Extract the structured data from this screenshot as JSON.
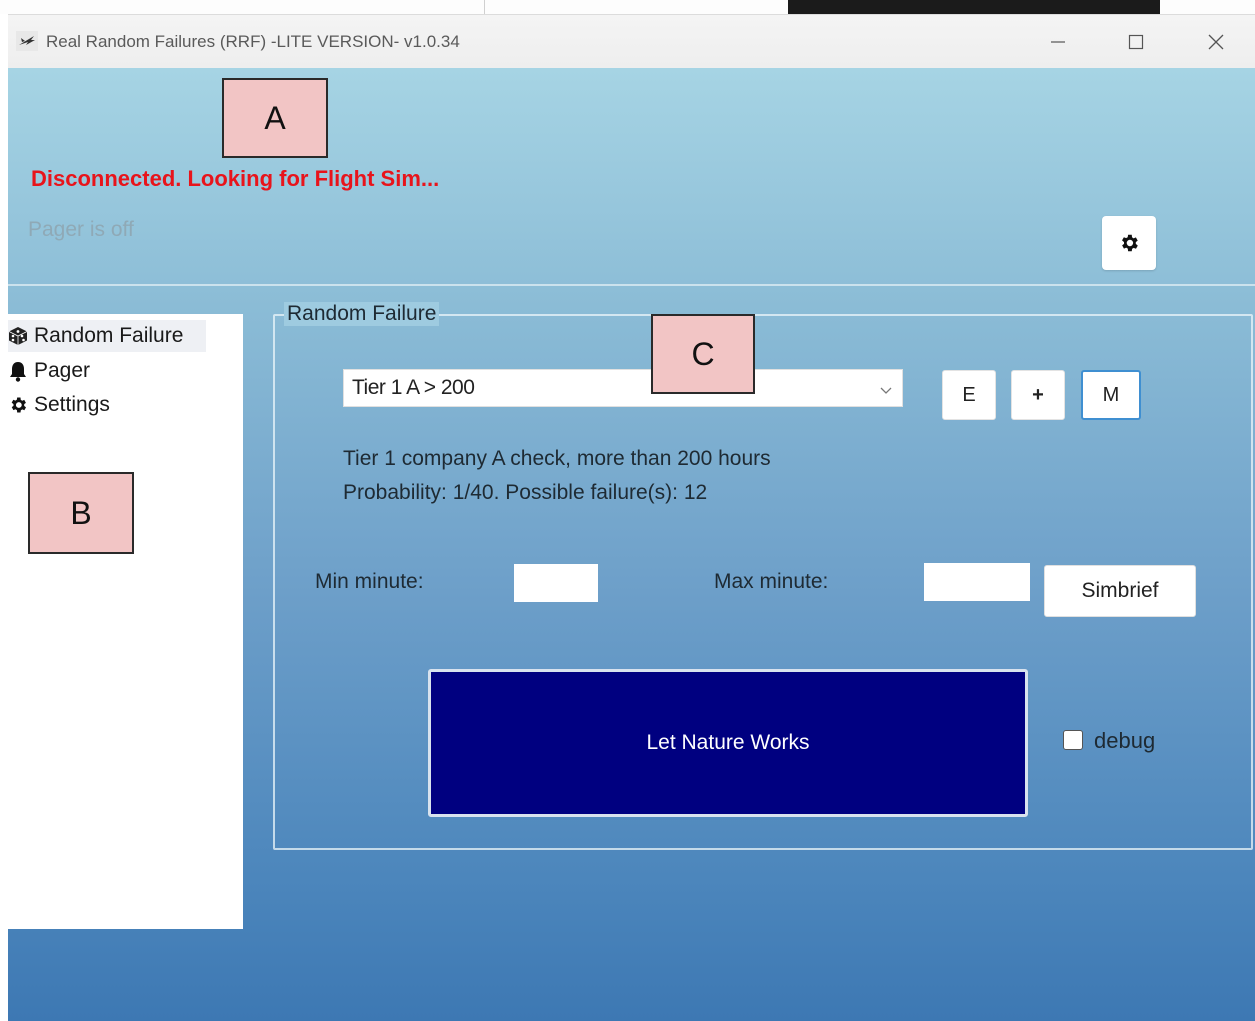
{
  "window": {
    "title": "Real Random Failures (RRF) -LITE VERSION- v1.0.34"
  },
  "annotations": {
    "a": "A",
    "b": "B",
    "c": "C"
  },
  "status": {
    "connection": "Disconnected. Looking for Flight Sim...",
    "pager": "Pager is off"
  },
  "sidebar": {
    "items": [
      {
        "label": "Random Failure",
        "icon": "dice-icon",
        "selected": true
      },
      {
        "label": "Pager",
        "icon": "bell-icon"
      },
      {
        "label": "Settings",
        "icon": "gear-icon"
      }
    ]
  },
  "random_failure": {
    "group_title": "Random Failure",
    "tier_selected": "Tier 1 A > 200",
    "buttons": {
      "e": "E",
      "plus": "+",
      "m": "M"
    },
    "description": "Tier 1 company A check, more than 200 hours",
    "probability": "Probability: 1/40. Possible failure(s): 12",
    "min_label": "Min minute:",
    "min_value": "",
    "max_label": "Max minute:",
    "max_value": "",
    "simbrief_label": "Simbrief",
    "main_button": "Let Nature Works",
    "debug_label": "debug",
    "debug_checked": false
  },
  "colors": {
    "status_error": "#e8141b",
    "main_button_bg": "#000080",
    "accent_border": "#3f8fd1"
  }
}
